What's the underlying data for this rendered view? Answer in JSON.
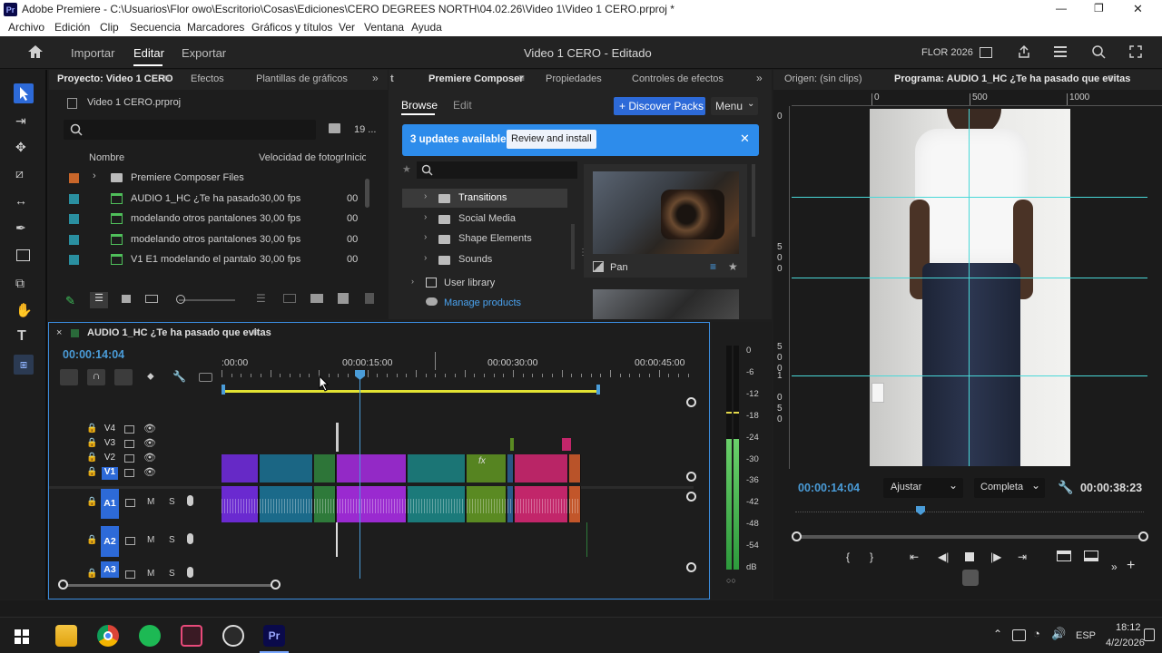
{
  "window": {
    "title": "Adobe Premiere - C:\\Usuarios\\Flor owo\\Escritorio\\Cosas\\Ediciones\\CERO DEGREES NORTH\\04.02.26\\Video 1\\Video 1 CERO.prproj *",
    "minimize": "—",
    "restore": "❐",
    "close": "✕"
  },
  "menu": [
    "Archivo",
    "Edición",
    "Clip",
    "Secuencia",
    "Marcadores",
    "Gráficos y títulos",
    "Ver",
    "Ventana",
    "Ayuda"
  ],
  "topbar": {
    "import": "Importar",
    "edit": "Editar",
    "export": "Exportar",
    "doc_title": "Video 1 CERO - Editado",
    "user": "FLOR 2026"
  },
  "project": {
    "tabs": [
      "Proyecto: Video 1 CERO",
      "Efectos",
      "Plantillas de gráficos"
    ],
    "file": "Video 1 CERO.prproj",
    "count": "19 ...",
    "search_placeholder": "",
    "columns": [
      "Nombre",
      "Velocidad de fotogr",
      "Inicio"
    ],
    "items": [
      {
        "name": "Premiere Composer Files",
        "fps": "",
        "start": "",
        "color": "#c8662a",
        "type": "folder"
      },
      {
        "name": "AUDIO 1_HC ¿Te ha pasado",
        "fps": "30,00 fps",
        "start": "00",
        "color": "#2a8fa0",
        "type": "seq"
      },
      {
        "name": "modelando otros pantalones",
        "fps": "30,00 fps",
        "start": "00",
        "color": "#2a8fa0",
        "type": "seq"
      },
      {
        "name": "modelando otros pantalones",
        "fps": "30,00 fps",
        "start": "00",
        "color": "#2a8fa0",
        "type": "seq"
      },
      {
        "name": "V1 E1 modelando el pantalo",
        "fps": "30,00 fps",
        "start": "00",
        "color": "#2a8fa0",
        "type": "seq"
      }
    ]
  },
  "composer": {
    "tabs": [
      "Premiere Composer",
      "Propiedades",
      "Controles de efectos"
    ],
    "browse": "Browse",
    "edit": "Edit",
    "discover": "+ Discover Packs",
    "menu": "Menu",
    "updates": "3 updates available",
    "review": "Review and install",
    "tree": [
      "Transitions",
      "Social Media",
      "Shape Elements",
      "Sounds"
    ],
    "user_library": "User library",
    "manage": "Manage products",
    "card_label": "Pan"
  },
  "monitor": {
    "source_tab": "Origen: (sin clips)",
    "program_tab": "Programa: AUDIO 1_HC ¿Te ha pasado que evitas",
    "ruler": [
      "0",
      "500",
      "1000"
    ],
    "vruler": [
      "0",
      "5",
      "0",
      "0",
      "5",
      "0",
      "0",
      "1",
      "0",
      "5",
      "0"
    ],
    "timecode": "00:00:14:04",
    "fit": "Ajustar",
    "quality": "Completa",
    "duration": "00:00:38:23"
  },
  "timeline": {
    "seq_name": "AUDIO 1_HC ¿Te ha pasado que evitas",
    "timecode": "00:00:14:04",
    "ruler": [
      ":00:00",
      "00:00:15:00",
      "00:00:30:00",
      "00:00:45:00"
    ],
    "vtracks": [
      "V4",
      "V3",
      "V2",
      "V1"
    ],
    "atracks": [
      "A1",
      "A2",
      "A3"
    ],
    "m": "M",
    "s": "S",
    "fx": "fx"
  },
  "meter": {
    "labels": [
      "0",
      "-6",
      "-12",
      "-18",
      "-24",
      "-30",
      "-36",
      "-42",
      "-48",
      "-54",
      "dB"
    ],
    "level": 0.62
  },
  "taskbar": {
    "time": "18:12",
    "date": "4/2/2026",
    "lang": "ESP"
  },
  "colors": {
    "accent": "#2d8ceb",
    "playhead": "#4a9cd8",
    "yellow": "#e3e333"
  }
}
